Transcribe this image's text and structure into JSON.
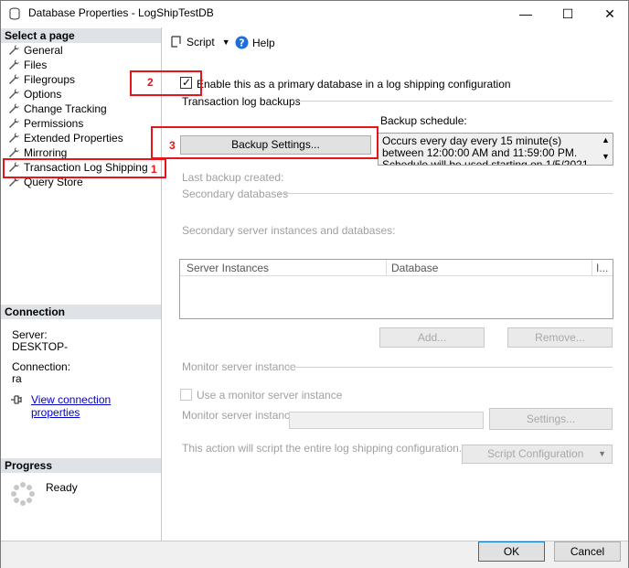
{
  "window": {
    "title": "Database Properties - LogShipTestDB",
    "minimize_glyph": "—",
    "maximize_glyph": "☐",
    "close_glyph": "✕"
  },
  "sidebar": {
    "select_header": "Select a page",
    "items": [
      {
        "label": "General"
      },
      {
        "label": "Files"
      },
      {
        "label": "Filegroups"
      },
      {
        "label": "Options"
      },
      {
        "label": "Change Tracking"
      },
      {
        "label": "Permissions"
      },
      {
        "label": "Extended Properties"
      },
      {
        "label": "Mirroring"
      },
      {
        "label": "Transaction Log Shipping"
      },
      {
        "label": "Query Store"
      }
    ],
    "connection_header": "Connection",
    "server_label": "Server:",
    "server_value": "DESKTOP-",
    "connection_label": "Connection:",
    "connection_value": "ra",
    "view_connection_link": "View connection properties",
    "progress_header": "Progress",
    "progress_status": "Ready"
  },
  "toolbar": {
    "script_label": "Script",
    "help_label": "Help"
  },
  "main": {
    "enable_primary_label": "Enable this as a primary database in a log shipping configuration",
    "enable_primary_checked": true,
    "transaction_log_backups_label": "Transaction log backups",
    "backup_schedule_label": "Backup schedule:",
    "backup_schedule_text": "Occurs every day every 15 minute(s) between 12:00:00 AM and 11:59:00 PM. Schedule will be used starting on 1/5/2021.",
    "backup_settings_button": "Backup Settings...",
    "last_backup_label": "Last backup created:",
    "secondary_databases_label": "Secondary databases",
    "secondary_instances_label": "Secondary server instances and databases:",
    "grid_columns": [
      "Server Instances",
      "Database",
      "I..."
    ],
    "add_button": "Add...",
    "remove_button": "Remove...",
    "monitor_server_label": "Monitor server instance",
    "use_monitor_label": "Use a monitor server instance",
    "monitor_instance_label": "Monitor server instance",
    "settings_button": "Settings...",
    "script_note": "This action will script the entire log shipping configuration.",
    "script_config_button": "Script Configuration"
  },
  "footer": {
    "ok_button": "OK",
    "cancel_button": "Cancel"
  },
  "annotations": {
    "one": "1",
    "two": "2",
    "three": "3",
    "color": "#e8141c"
  }
}
